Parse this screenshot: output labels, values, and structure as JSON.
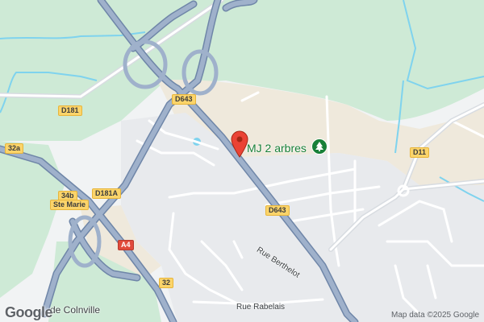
{
  "map": {
    "roads": {
      "d643_north": "D643",
      "d643_south": "D643",
      "d181": "D181",
      "d181a": "D181A",
      "d11": "D11",
      "n32a": "32a",
      "n34b": "34b",
      "n32": "32",
      "a4": "A4"
    },
    "place_labels": {
      "ste_marie": "Ste Marie",
      "colinville_fragment": "de Colnville"
    },
    "street_labels": {
      "rue_berthelot": "Rue Berthelot",
      "rue_rabelais": "Rue Rabelais"
    },
    "poi": {
      "name": "MJ 2 arbres",
      "icon": "tree-icon"
    },
    "marker": {
      "icon": "map-pin-icon",
      "color": "#ea4335"
    },
    "attribution": "Map data ©2025 Google",
    "logo": "Google",
    "colors": {
      "land": "#f1f3f4",
      "green": "#ceead6",
      "sand": "#efe9dc",
      "highway": "#8ea1bd",
      "water": "#7fd3ee"
    }
  }
}
